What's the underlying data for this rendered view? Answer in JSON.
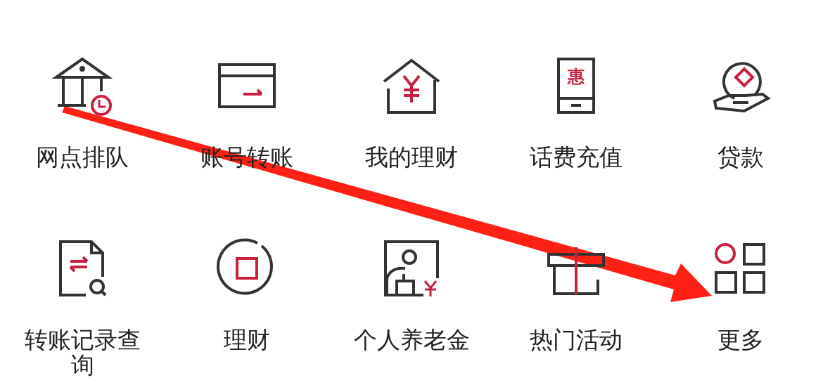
{
  "grid": {
    "items": [
      {
        "label": "网点排队"
      },
      {
        "label": "账号转账"
      },
      {
        "label": "我的理财"
      },
      {
        "label": "话费充值",
        "icon_text": "惠"
      },
      {
        "label": "贷款"
      },
      {
        "label": "转账记录查询"
      },
      {
        "label": "理财"
      },
      {
        "label": "个人养老金"
      },
      {
        "label": "热门活动"
      },
      {
        "label": "更多"
      }
    ]
  }
}
